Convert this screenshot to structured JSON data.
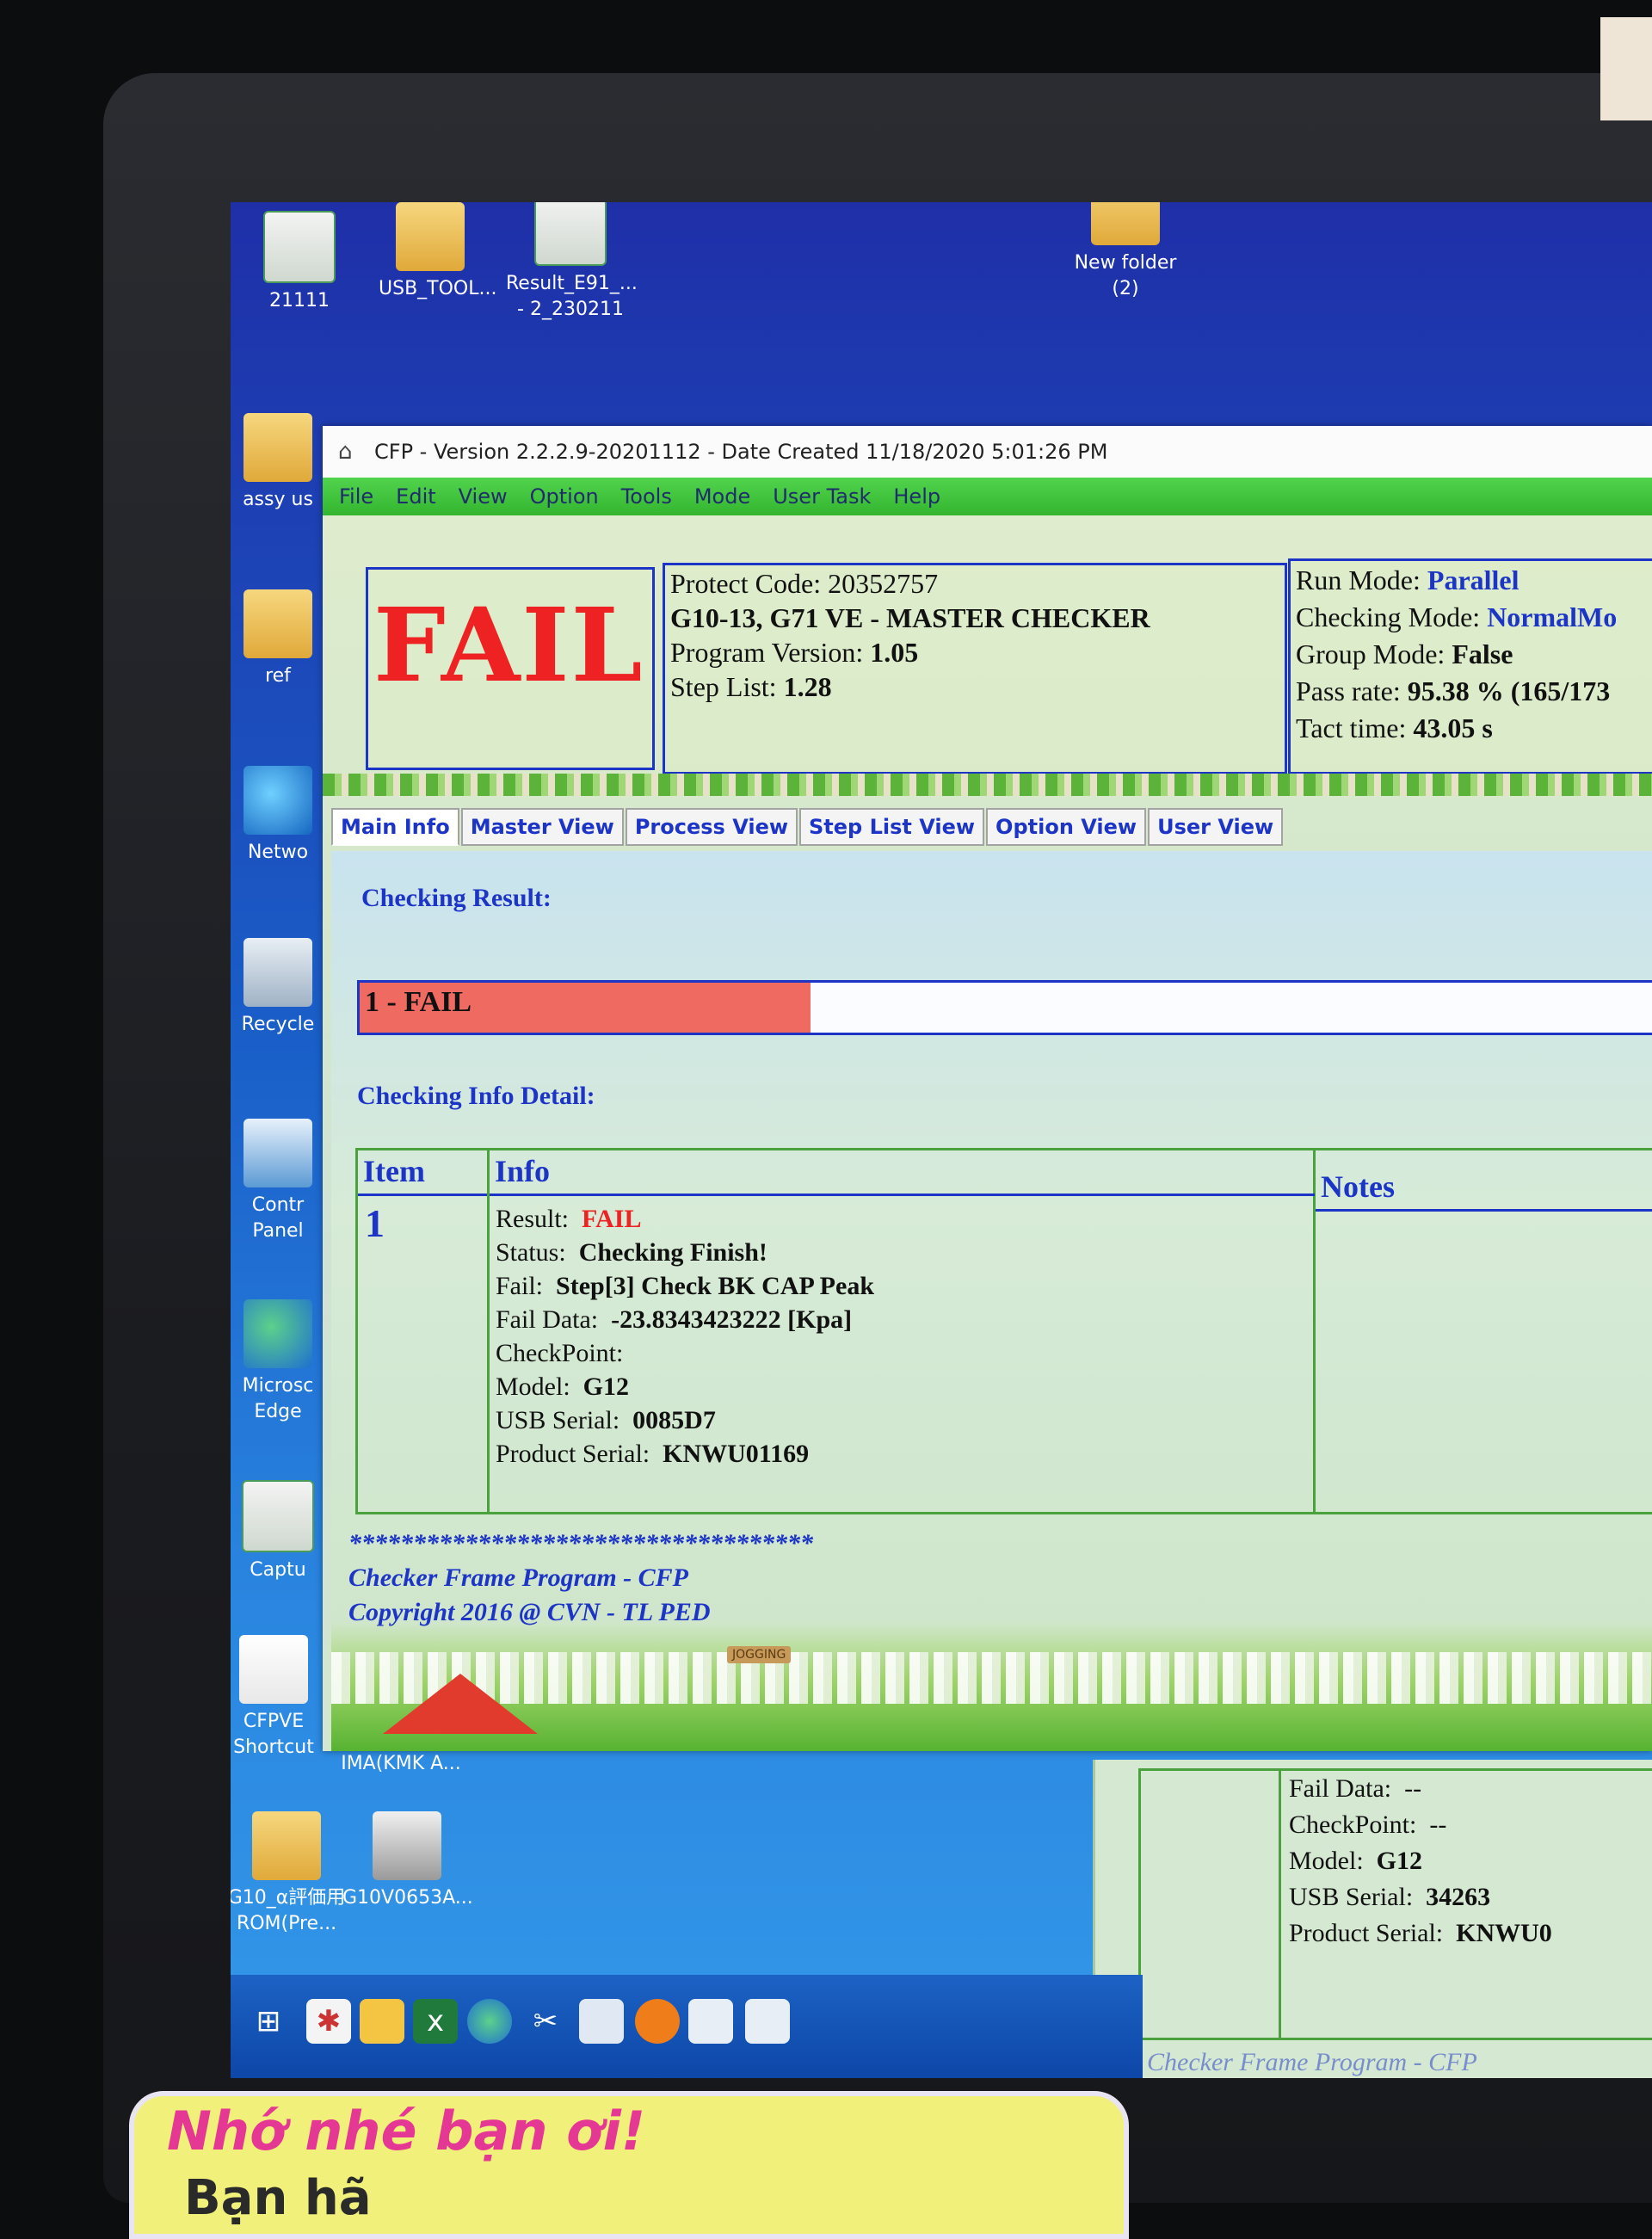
{
  "desktop": {
    "icons": [
      {
        "label": "21111"
      },
      {
        "label": "USB_TOOL..."
      },
      {
        "label": "Result_E91_...",
        "label2": "- 2_230211"
      },
      {
        "label": "New folder",
        "label2": "(2)"
      },
      {
        "label": "assy us"
      },
      {
        "label": "ref"
      },
      {
        "label": "Netwo"
      },
      {
        "label": "Recycle"
      },
      {
        "label": "Contr",
        "label2": "Panel"
      },
      {
        "label": "Microsc",
        "label2": "Edge"
      },
      {
        "label": "Captu"
      },
      {
        "label": "CFPVE",
        "label2": "Shortcut"
      },
      {
        "label": "IMA(KMK A..."
      },
      {
        "label": "G10_α評価用",
        "label2": "ROM(Pre..."
      },
      {
        "label": "G10V0653A..."
      }
    ]
  },
  "window": {
    "title": "CFP - Version 2.2.2.9-20201112 - Date Created 11/18/2020 5:01:26 PM",
    "menu": [
      "File",
      "Edit",
      "View",
      "Option",
      "Tools",
      "Mode",
      "User Task",
      "Help"
    ]
  },
  "header": {
    "status_big": "FAIL",
    "protect_code_label": "Protect Code:",
    "protect_code": "20352757",
    "checker_name": "G10-13, G71 VE - MASTER CHECKER",
    "program_version_label": "Program Version:",
    "program_version": "1.05",
    "step_list_label": "Step List:",
    "step_list": "1.28",
    "run_mode_label": "Run Mode:",
    "run_mode": "Parallel",
    "checking_mode_label": "Checking Mode:",
    "checking_mode": "NormalMo",
    "group_mode_label": "Group Mode:",
    "group_mode": "False",
    "pass_rate_label": "Pass rate:",
    "pass_rate": "95.38 % (165/173",
    "tact_time_label": "Tact time:",
    "tact_time": "43.05 s"
  },
  "tabs": [
    "Main Info",
    "Master View",
    "Process View",
    "Step List View",
    "Option View",
    "User View"
  ],
  "main": {
    "checking_result_label": "Checking Result:",
    "result_bar_text": "1 - FAIL",
    "result_fill_fraction": 0.34,
    "checking_info_detail_label": "Checking Info Detail:",
    "table": {
      "headers": [
        "Item",
        "Info",
        "Notes"
      ],
      "item": "1",
      "rows": [
        {
          "label": "Result:",
          "value": "FAIL"
        },
        {
          "label": "Status:",
          "value": "Checking Finish!"
        },
        {
          "label": "Fail:",
          "value": "Step[3] Check BK CAP Peak"
        },
        {
          "label": "Fail Data:",
          "value": "-23.8343423222 [Kpa]"
        },
        {
          "label": "CheckPoint:",
          "value": ""
        },
        {
          "label": "Model:",
          "value": "G12"
        },
        {
          "label": "USB Serial:",
          "value": "0085D7"
        },
        {
          "label": "Product Serial:",
          "value": "KNWU01169"
        }
      ]
    },
    "footer_stars": "************************************",
    "footer_line1": "Checker Frame Program - CFP",
    "footer_line2": "Copyright 2016 @ CVN - TL PED",
    "fence_sign": "JOGGING"
  },
  "background_window": {
    "rows": [
      {
        "label": "Fail Data:",
        "value": "--"
      },
      {
        "label": "CheckPoint:",
        "value": "--"
      },
      {
        "label": "Model:",
        "value": "G12"
      },
      {
        "label": "USB Serial:",
        "value": "34263"
      },
      {
        "label": "Product Serial:",
        "value": "KNWU0"
      }
    ],
    "footer": "Checker Frame Program - CFP"
  },
  "sticker": {
    "line1": "Nhớ nhé bạn ơi!",
    "line2": "Bạn hã"
  },
  "colors": {
    "fail_red": "#ee2222",
    "accent_blue": "#1d35c7",
    "menu_green": "#3fc43b",
    "table_green": "#4aa13e",
    "result_fill": "#ef6b62"
  }
}
